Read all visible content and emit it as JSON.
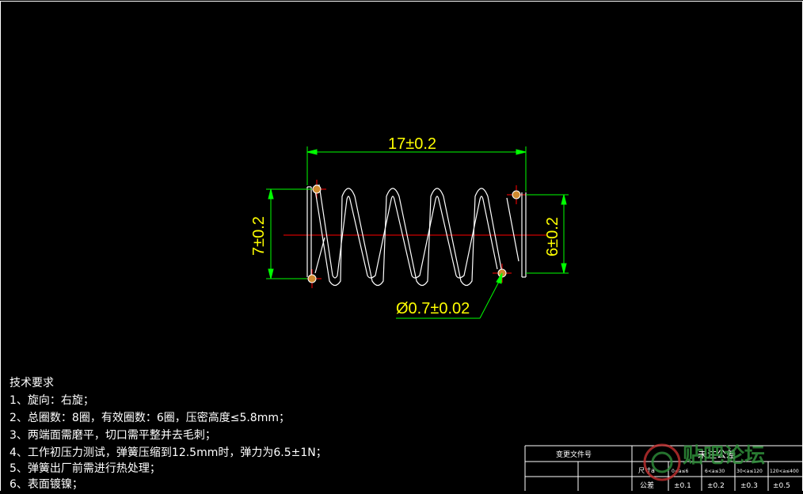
{
  "dimensions": {
    "length": "17±0.2",
    "outer_diameter": "7±0.2",
    "inner_diameter": "6±0.2",
    "wire_diameter": "Ø0.7±0.02"
  },
  "requirements": {
    "title": "技术要求",
    "items": [
      "1、旋向：右旋；",
      "2、总圈数：8圈，有效圈数：6圈，压密高度≤5.8mm；",
      "3、两端面需磨平，切口需平整并去毛刺；",
      "4、工作初压力测试，弹簧压缩到12.5mm时，弹力为6.5±1N；",
      "5、弹簧出厂前需进行热处理；",
      "6、表面镀镍；"
    ]
  },
  "title_block": {
    "change_doc_label": "变更文件号",
    "tolerance_header": "未注公差",
    "size_label": "尺寸a",
    "tolerance_label": "公差",
    "ranges": [
      "0<a≤6",
      "6<a≤30",
      "30<a≤120",
      "120<a≤400"
    ],
    "tolerances": [
      "±0.1",
      "±0.2",
      "±0.3",
      "±0.5"
    ]
  },
  "watermark": "贴吧论坛",
  "colors": {
    "dimension": "#00ff00",
    "dimension_text": "#ffff00",
    "centerline": "#ff0000",
    "outline": "#ffffff",
    "section_hatch": "#d08a30"
  }
}
